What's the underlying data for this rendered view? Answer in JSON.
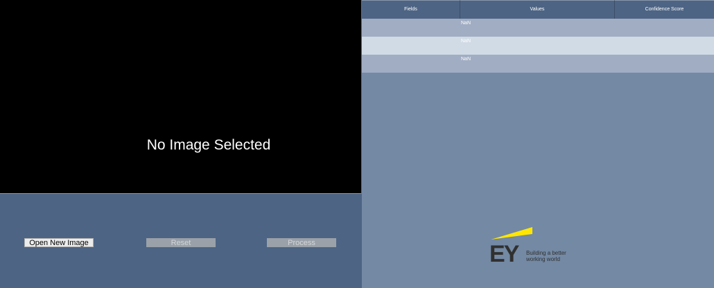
{
  "image_panel": {
    "placeholder_text": "No Image Selected"
  },
  "buttons": {
    "open_label": "Open New Image",
    "reset_label": "Reset",
    "process_label": "Process"
  },
  "table": {
    "headers": {
      "fields": "Fields",
      "values": "Values",
      "confidence": "Confidence Score"
    },
    "rows": [
      {
        "field": "",
        "value": "NaN",
        "confidence": ""
      },
      {
        "field": "",
        "value": "NaN",
        "confidence": ""
      },
      {
        "field": "",
        "value": "NaN",
        "confidence": ""
      }
    ]
  },
  "logo": {
    "mark": "EY",
    "tagline_line1": "Building a better",
    "tagline_line2": "working world",
    "accent_color": "#ffe600"
  }
}
